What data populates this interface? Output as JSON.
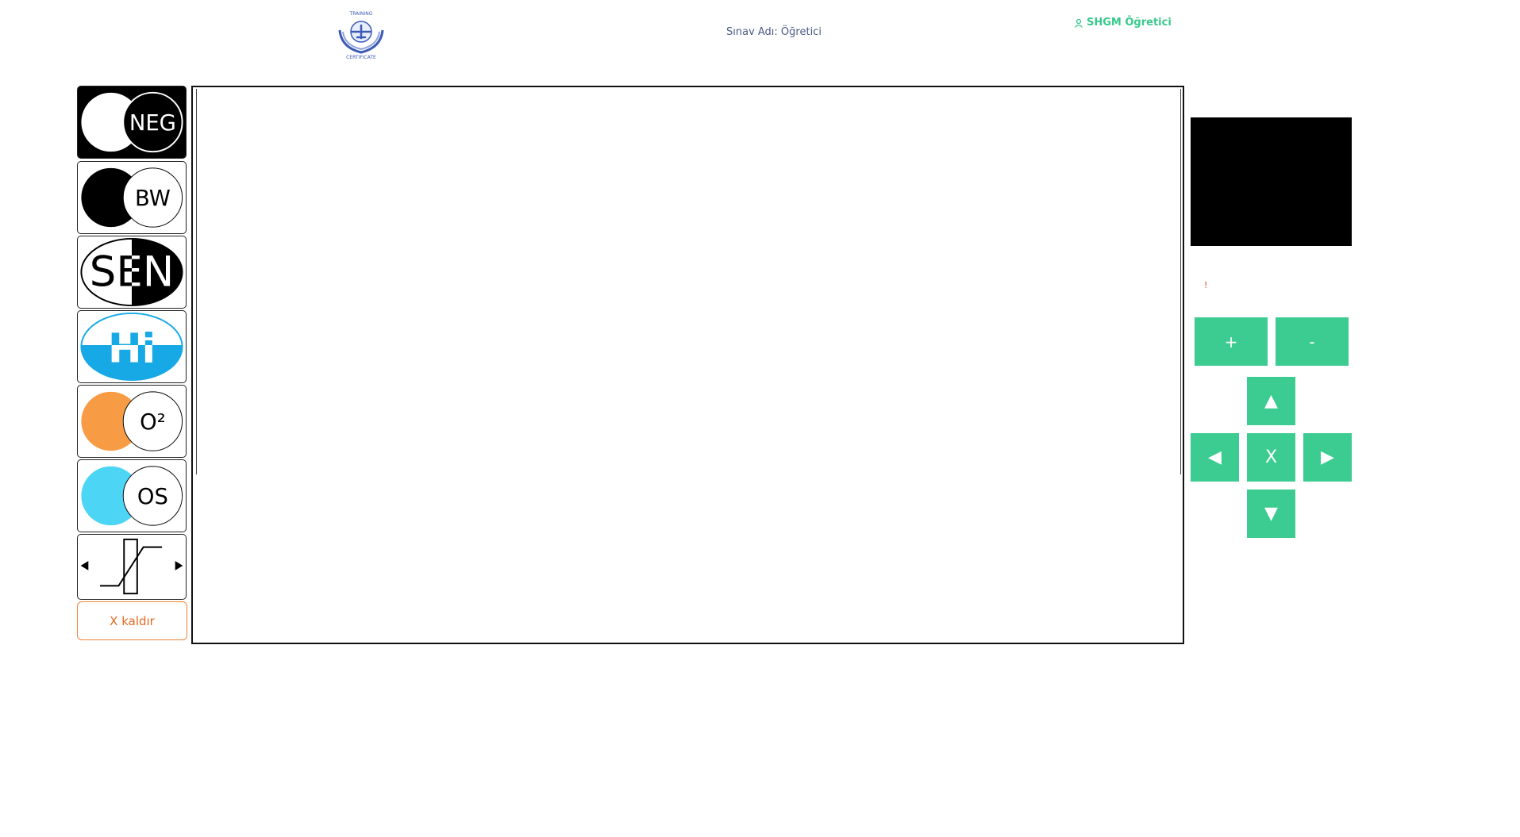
{
  "header": {
    "logo_icon": "certificate-wreath-airplane-icon",
    "exam_name": "Sınav Adı: Öğretici",
    "user_label": "SHGM Öğretici",
    "user_icon": "user-icon"
  },
  "tools": [
    {
      "id": "neg",
      "label": "NEG"
    },
    {
      "id": "bw",
      "label": "BW"
    },
    {
      "id": "sen",
      "label": "SEN"
    },
    {
      "id": "hi",
      "label": "Hi"
    },
    {
      "id": "o2",
      "label": "O²"
    },
    {
      "id": "os",
      "label": "OS"
    },
    {
      "id": "contrast",
      "label": ""
    }
  ],
  "remove_button": "X kaldır",
  "controls": {
    "zoom_in": "+",
    "zoom_out": "-",
    "up": "▲",
    "left": "◀",
    "reset": "X",
    "right": "▶",
    "down": "▼"
  },
  "colors": {
    "accent": "#3ccb90",
    "orange": "#f79c45",
    "cyan": "#4dd5f5",
    "hi_blue": "#16a9e6",
    "remove": "#e06a22"
  }
}
